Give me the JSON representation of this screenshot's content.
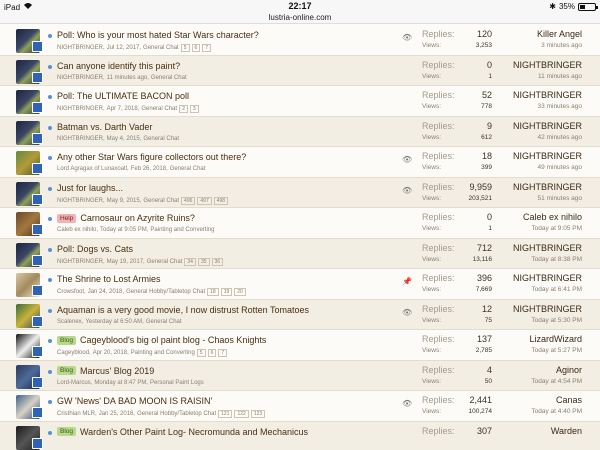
{
  "status_bar": {
    "device": "iPad",
    "time": "22:17",
    "battery": "35%",
    "battery_level": 0.35
  },
  "url_bar": {
    "url": "lustria-online.com"
  },
  "labels": {
    "replies": "Replies:",
    "views": "Views:"
  },
  "threads": [
    {
      "avatar": "ng",
      "title": "Poll: Who is your most hated Star Wars character?",
      "prefix": "",
      "author": "NIGHTBRINGER,",
      "date": "Jul 12, 2017,",
      "forum": "General Chat",
      "pages": [
        "5",
        "6",
        "7"
      ],
      "icon": "eye-icon",
      "replies": "120",
      "views": "3,253",
      "last_user": "Killer Angel",
      "last_time": "3 minutes ago"
    },
    {
      "avatar": "ng",
      "title": "Can anyone identify this paint?",
      "prefix": "",
      "author": "NIGHTBRINGER,",
      "date": "11 minutes ago,",
      "forum": "General Chat",
      "pages": [],
      "icon": "",
      "replies": "0",
      "views": "1",
      "last_user": "NIGHTBRINGER",
      "last_time": "11 minutes ago"
    },
    {
      "avatar": "ng",
      "title": "Poll: The ULTIMATE BACON poll",
      "prefix": "",
      "author": "NIGHTBRINGER,",
      "date": "Apr 7, 2018,",
      "forum": "General Chat",
      "pages": [
        "2",
        "3"
      ],
      "icon": "",
      "replies": "52",
      "views": "778",
      "last_user": "NIGHTBRINGER",
      "last_time": "33 minutes ago"
    },
    {
      "avatar": "ng",
      "title": "Batman vs. Darth Vader",
      "prefix": "",
      "author": "NIGHTBRINGER,",
      "date": "May 4, 2015,",
      "forum": "General Chat",
      "pages": [],
      "icon": "",
      "replies": "9",
      "views": "612",
      "last_user": "NIGHTBRINGER",
      "last_time": "42 minutes ago"
    },
    {
      "avatar": "lizard",
      "title": "Any other Star Wars figure collectors out there?",
      "prefix": "",
      "author": "Lord Agragax of Lunaxoatl,",
      "date": "Feb 26, 2018,",
      "forum": "General Chat",
      "pages": [],
      "icon": "eye-icon",
      "replies": "18",
      "views": "399",
      "last_user": "NIGHTBRINGER",
      "last_time": "49 minutes ago"
    },
    {
      "avatar": "ng",
      "title": "Just for laughs...",
      "prefix": "",
      "author": "NIGHTBRINGER,",
      "date": "May 9, 2015,",
      "forum": "General Chat",
      "pages": [
        "496",
        "497",
        "498"
      ],
      "icon": "eye-icon",
      "replies": "9,959",
      "views": "203,521",
      "last_user": "NIGHTBRINGER",
      "last_time": "51 minutes ago"
    },
    {
      "avatar": "caleb",
      "title": "Carnosaur on Azyrite Ruins?",
      "prefix": "Help",
      "author": "Caleb ex nihilo,",
      "date": "Today at 9:05 PM,",
      "forum": "Painting and Converting",
      "pages": [],
      "icon": "",
      "replies": "0",
      "views": "1",
      "last_user": "Caleb ex nihilo",
      "last_time": "Today at 9:05 PM"
    },
    {
      "avatar": "ng",
      "title": "Poll: Dogs vs. Cats",
      "prefix": "",
      "author": "NIGHTBRINGER,",
      "date": "May 19, 2017,",
      "forum": "General Chat",
      "pages": [
        "34",
        "35",
        "36"
      ],
      "icon": "",
      "replies": "712",
      "views": "13,116",
      "last_user": "NIGHTBRINGER",
      "last_time": "Today at 8:38 PM"
    },
    {
      "avatar": "crows",
      "title": "The Shrine to Lost Armies",
      "prefix": "",
      "author": "Crowsfoot,",
      "date": "Jan 24, 2018,",
      "forum": "General Hobby/Tabletop Chat",
      "pages": [
        "18",
        "19",
        "20"
      ],
      "icon": "pin-icon",
      "replies": "396",
      "views": "7,669",
      "last_user": "NIGHTBRINGER",
      "last_time": "Today at 6:41 PM"
    },
    {
      "avatar": "scal",
      "title": "Aquaman is a very good movie, I now distrust Rotten Tomatoes",
      "prefix": "",
      "author": "Scalenex,",
      "date": "Yesterday at 6:50 AM,",
      "forum": "General Chat",
      "pages": [],
      "icon": "eye-icon",
      "replies": "12",
      "views": "75",
      "last_user": "NIGHTBRINGER",
      "last_time": "Today at 5:30 PM"
    },
    {
      "avatar": "cage",
      "title": "Cageyblood's big ol paint blog - Chaos Knights",
      "prefix": "Blog",
      "author": "Cageyblood,",
      "date": "Apr 20, 2018,",
      "forum": "Painting and Converting",
      "pages": [
        "5",
        "6",
        "7"
      ],
      "icon": "",
      "replies": "137",
      "views": "2,785",
      "last_user": "LizardWizard",
      "last_time": "Today at 5:27 PM"
    },
    {
      "avatar": "marcus",
      "title": "Marcus' Blog 2019",
      "prefix": "Blog",
      "author": "Lord-Marcus,",
      "date": "Monday at 8:47 PM,",
      "forum": "Personal Paint Logs",
      "pages": [],
      "icon": "",
      "replies": "4",
      "views": "50",
      "last_user": "Aginor",
      "last_time": "Today at 4:54 PM"
    },
    {
      "avatar": "crist",
      "title": "GW 'News' DA BAD MOON IS RAISIN'",
      "prefix": "",
      "author": "Cristhian MLR,",
      "date": "Jan 25, 2016,",
      "forum": "General Hobby/Tabletop Chat",
      "pages": [
        "121",
        "122",
        "123"
      ],
      "icon": "eye-icon",
      "replies": "2,441",
      "views": "100,274",
      "last_user": "Canas",
      "last_time": "Today at 4:40 PM"
    },
    {
      "avatar": "dark",
      "title": "Warden's Other Paint Log- Necromunda and Mechanicus",
      "prefix": "Blog",
      "author": "",
      "date": "",
      "forum": "",
      "pages": [],
      "icon": "",
      "replies": "307",
      "views": "",
      "last_user": "Warden",
      "last_time": ""
    }
  ]
}
